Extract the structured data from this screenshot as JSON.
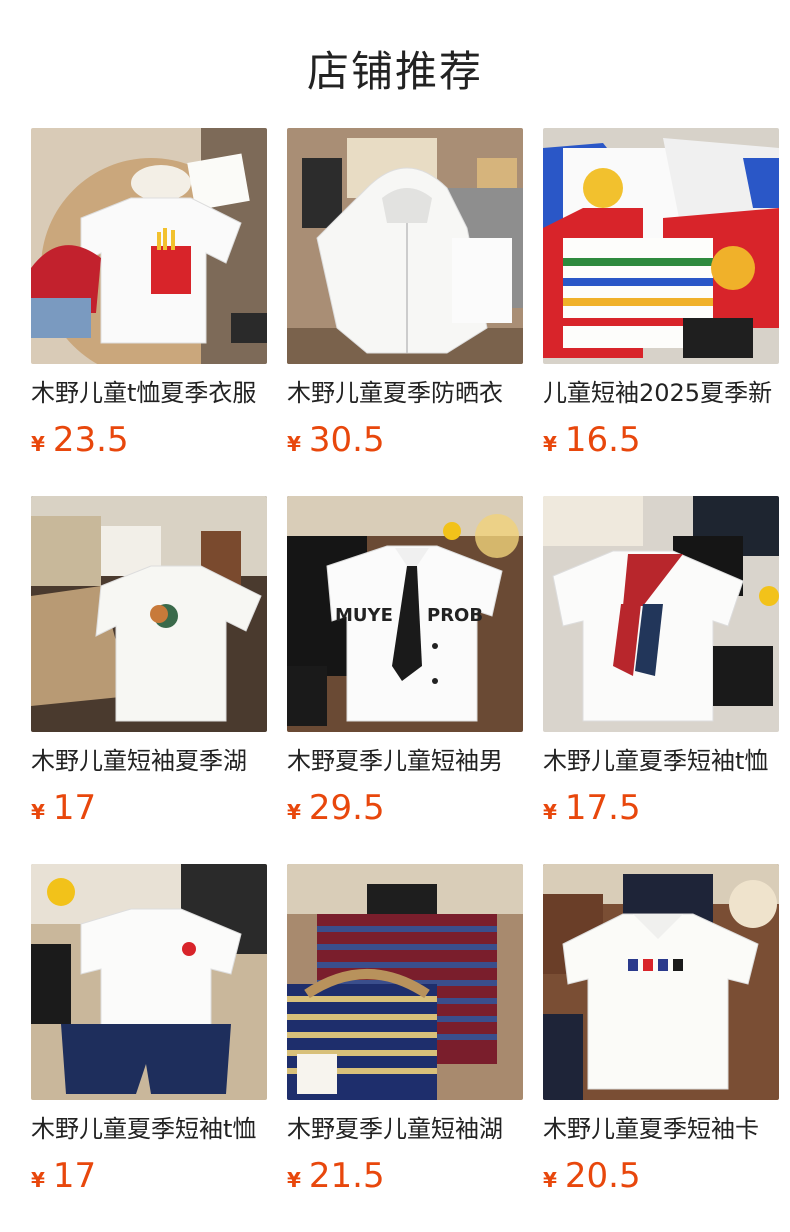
{
  "header": {
    "title": "店铺推荐"
  },
  "products": [
    {
      "title": "木野儿童t恤夏季衣服",
      "currency": "¥",
      "price": "23.5"
    },
    {
      "title": "木野儿童夏季防晒衣",
      "currency": "¥",
      "price": "30.5"
    },
    {
      "title": "儿童短袖2025夏季新",
      "currency": "¥",
      "price": "16.5"
    },
    {
      "title": "木野儿童短袖夏季湖",
      "currency": "¥",
      "price": "17"
    },
    {
      "title": "木野夏季儿童短袖男",
      "currency": "¥",
      "price": "29.5"
    },
    {
      "title": "木野儿童夏季短袖t恤",
      "currency": "¥",
      "price": "17.5"
    },
    {
      "title": "木野儿童夏季短袖t恤",
      "currency": "¥",
      "price": "17"
    },
    {
      "title": "木野夏季儿童短袖湖",
      "currency": "¥",
      "price": "21.5"
    },
    {
      "title": "木野儿童夏季短袖卡",
      "currency": "¥",
      "price": "20.5"
    }
  ],
  "thumb_text": {
    "p5_shirt_left": "MUYE",
    "p5_shirt_right": "PROB"
  }
}
